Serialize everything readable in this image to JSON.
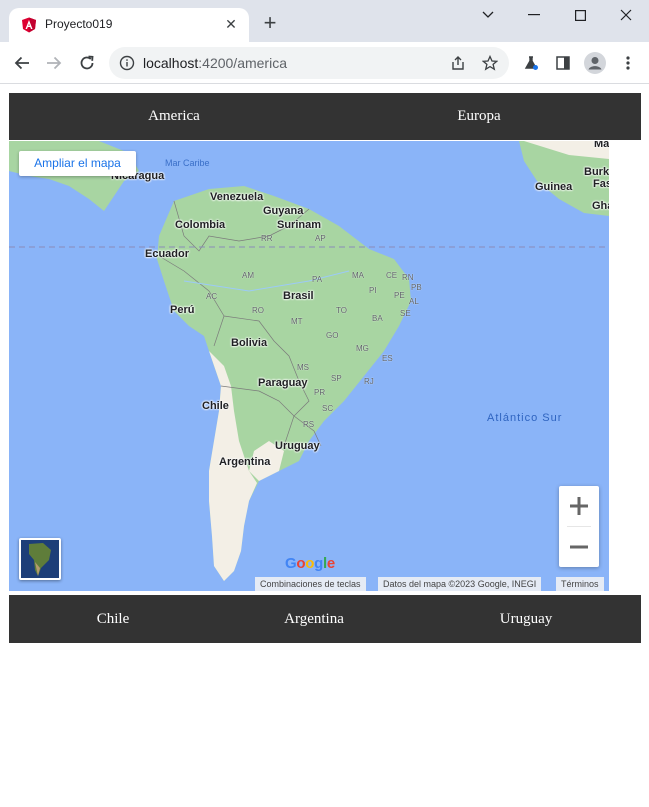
{
  "browser": {
    "tab_title": "Proyecto019",
    "url_host": "localhost",
    "url_path": ":4200/america",
    "tab_close_icon": "close-icon",
    "new_tab_icon": "plus-icon"
  },
  "app_nav": {
    "items": [
      {
        "label": "America"
      },
      {
        "label": "Europa"
      }
    ]
  },
  "map": {
    "enlarge_button": "Ampliar el mapa",
    "zoom_in_icon": "plus-icon",
    "zoom_out_icon": "minus-icon",
    "google_logo": "Google",
    "attribution": {
      "shortcuts": "Combinaciones de teclas",
      "data": "Datos del mapa ©2023 Google, INEGI",
      "terms": "Términos"
    },
    "labels": {
      "nicaragua": "Nicaragua",
      "mar_caribe": "Mar Caribe",
      "venezuela": "Venezuela",
      "guyana": "Guyana",
      "surinam": "Surinam",
      "colombia": "Colombia",
      "ecuador": "Ecuador",
      "peru": "Perú",
      "brasil": "Brasil",
      "bolivia": "Bolivia",
      "paraguay": "Paraguay",
      "chile": "Chile",
      "argentina": "Argentina",
      "uruguay": "Uruguay",
      "atlantico_sur": "Atlántico Sur",
      "guinea": "Guinea",
      "burk": "Burk",
      "fas": "Fas",
      "gha": "Gha",
      "ma": "Ma",
      "rr": "RR",
      "ap": "AP",
      "am": "AM",
      "pa": "PA",
      "ma_st": "MA",
      "ce": "CE",
      "rn": "RN",
      "pi": "PI",
      "pb": "PB",
      "pe": "PE",
      "al": "AL",
      "se": "SE",
      "ac": "AC",
      "ro": "RO",
      "to": "TO",
      "ba": "BA",
      "mt": "MT",
      "go": "GO",
      "mg": "MG",
      "es": "ES",
      "ms": "MS",
      "sp": "SP",
      "rj": "RJ",
      "pr": "PR",
      "sc": "SC",
      "rs": "RS"
    }
  },
  "city_nav": {
    "items": [
      {
        "label": "Chile"
      },
      {
        "label": "Argentina"
      },
      {
        "label": "Uruguay"
      }
    ]
  },
  "colors": {
    "nav_bg": "#333333",
    "ocean": "#8ab4f8",
    "land_green": "#a8d5a2",
    "land_beige": "#f3efe6",
    "link_blue": "#1a73e8"
  }
}
